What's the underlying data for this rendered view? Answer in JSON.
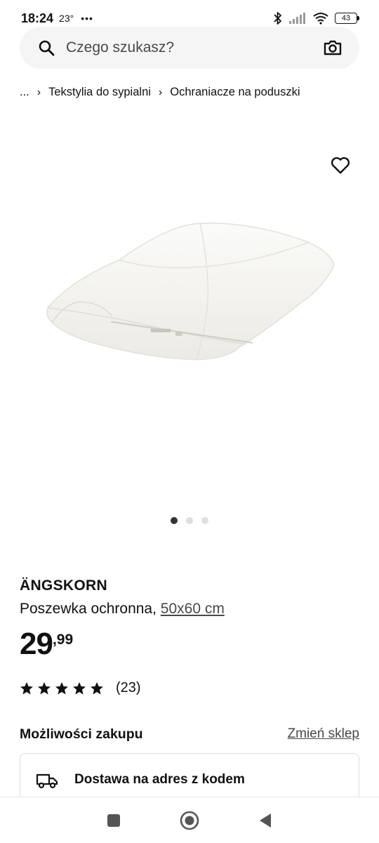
{
  "status_bar": {
    "time": "18:24",
    "temperature": "23°",
    "more": "•••",
    "battery": "43"
  },
  "search": {
    "placeholder": "Czego szukasz?",
    "icon": "search-icon",
    "camera_icon": "camera-icon"
  },
  "breadcrumb": {
    "ellipsis": "...",
    "items": [
      "Tekstylia do sypialni",
      "Ochraniacze na poduszki"
    ]
  },
  "product": {
    "name": "ÄNGSKORN",
    "description": "Poszewka ochronna,",
    "size": "50x60 cm",
    "price_int": "29",
    "price_dec": ",99",
    "rating_value": 5,
    "rating_count": "(23)",
    "image_count": 3,
    "active_image": 1
  },
  "purchase": {
    "title": "Możliwości zakupu",
    "change_store": "Zmień sklep",
    "delivery_title": "Dostawa na adres z kodem"
  },
  "colors": {
    "text": "#111111",
    "muted": "#484848",
    "search_bg": "#f5f5f5"
  }
}
